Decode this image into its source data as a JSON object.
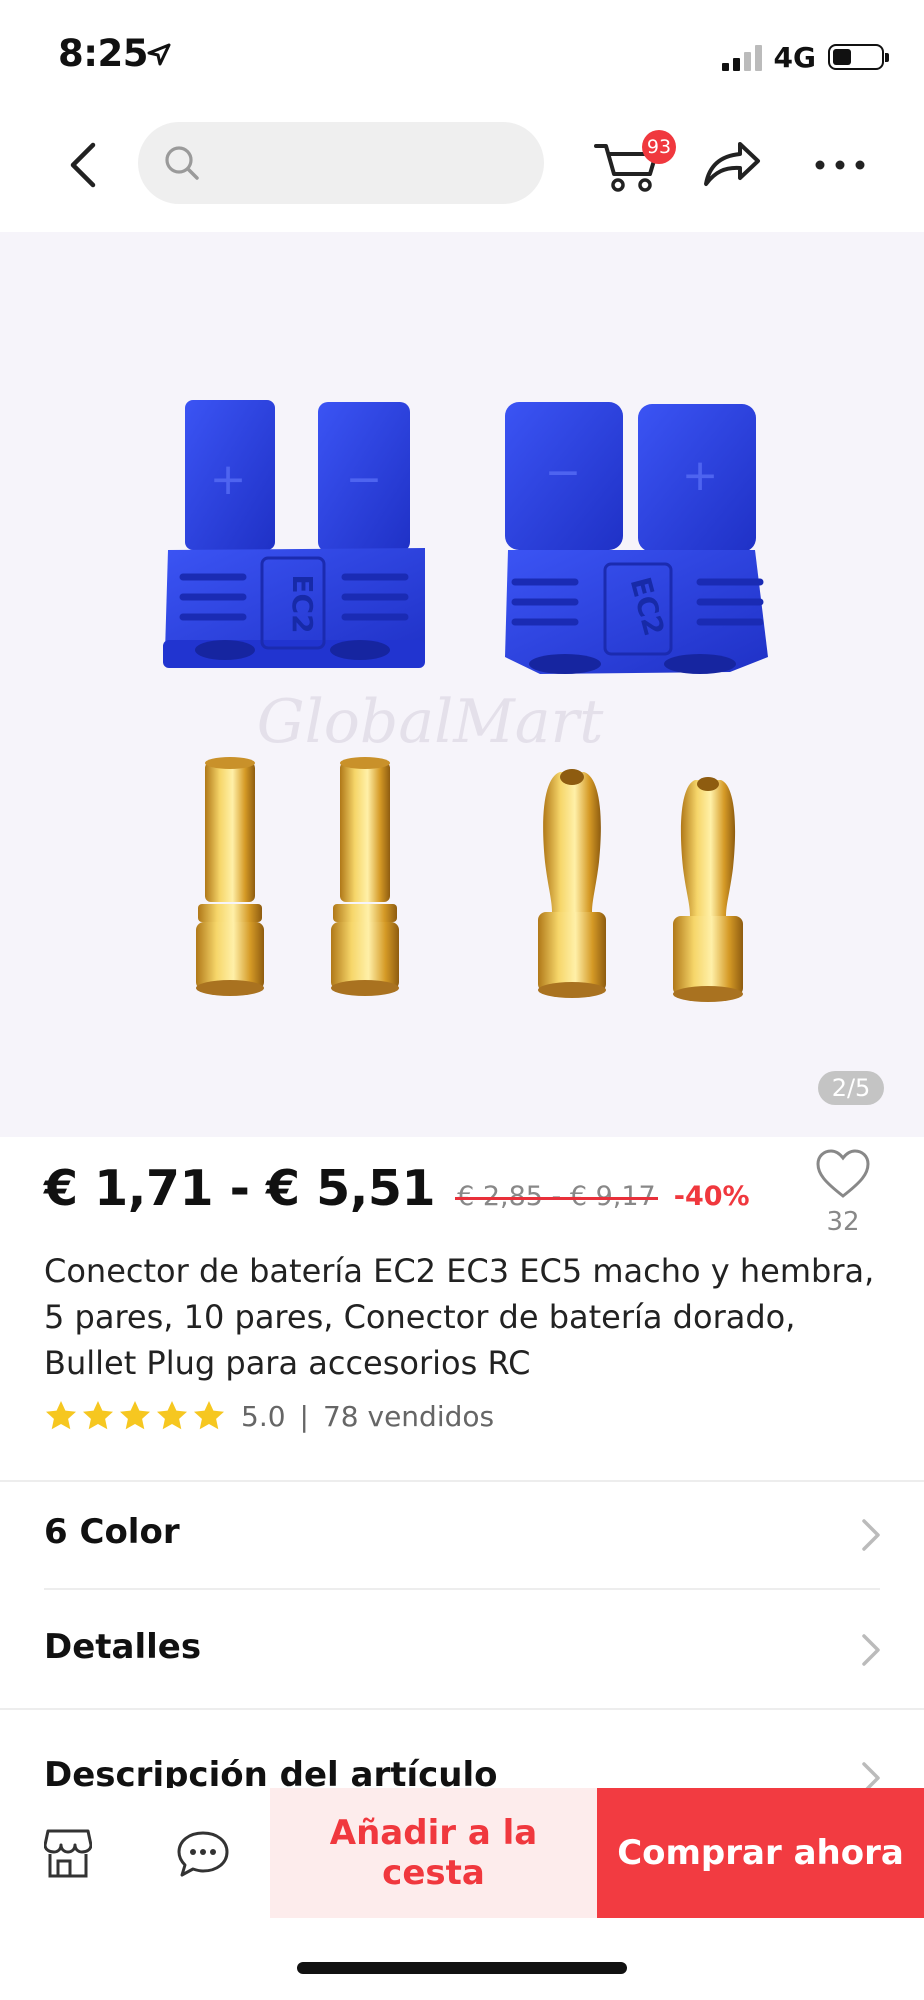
{
  "status_bar": {
    "time": "8:25",
    "network": "4G",
    "signal_bars_active": 2,
    "battery_level": 0.4
  },
  "nav": {
    "search_placeholder": "",
    "cart_count": "93"
  },
  "gallery": {
    "page_indicator": "2/5",
    "watermark": "GlobalMart",
    "connector_label": "EC2",
    "plus_sign": "+",
    "minus_sign": "−"
  },
  "product": {
    "price": "€ 1,71 - € 5,51",
    "original_price": "€ 2,85 - € 9,17",
    "discount": "-40%",
    "wishlist_count": "32",
    "title": "Conector de batería EC2 EC3 EC5 macho y hembra, 5 pares, 10 pares, Conector de batería dorado, Bullet Plug para accesorios RC",
    "rating": "5.0",
    "rating_stars": 5,
    "rating_separator": "|",
    "sold": "78 vendidos"
  },
  "options": [
    {
      "label": "6 Color"
    },
    {
      "label": "Detalles"
    },
    {
      "label": "Descripción del artículo"
    }
  ],
  "actions": {
    "add_to_cart": "Añadir a la cesta",
    "buy_now": "Comprar ahora"
  },
  "colors": {
    "accent": "#f0383e",
    "connector_blue": "#2a3fe0",
    "gold": "#d9a82f"
  }
}
